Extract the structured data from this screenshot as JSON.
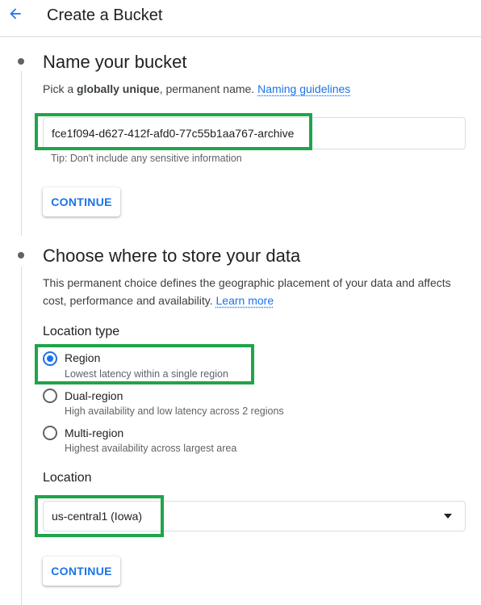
{
  "header": {
    "title": "Create a Bucket",
    "back_icon": "arrow-back-icon"
  },
  "name_section": {
    "title": "Name your bucket",
    "desc_prefix": "Pick a ",
    "desc_bold": "globally unique",
    "desc_suffix": ", permanent name. ",
    "guidelines_link": "Naming guidelines",
    "bucket_name": "fce1f094-d627-412f-afd0-77c55b1aa767-archive",
    "tip": "Tip: Don't include any sensitive information",
    "continue_label": "CONTINUE"
  },
  "storage_section": {
    "title": "Choose where to store your data",
    "desc_line1": "This permanent choice defines the geographic placement of your data and affects",
    "desc_line2": "cost, performance and availability. ",
    "learn_more": "Learn more",
    "location_type_label": "Location type",
    "options": [
      {
        "label": "Region",
        "sub": "Lowest latency within a single region",
        "selected": true
      },
      {
        "label": "Dual-region",
        "sub": "High availability and low latency across 2 regions",
        "selected": false
      },
      {
        "label": "Multi-region",
        "sub": "Highest availability across largest area",
        "selected": false
      }
    ],
    "location_label": "Location",
    "location_value": "us-central1 (Iowa)",
    "continue_label": "CONTINUE"
  },
  "colors": {
    "accent": "#1a73e8",
    "highlight": "#1fa54a"
  }
}
